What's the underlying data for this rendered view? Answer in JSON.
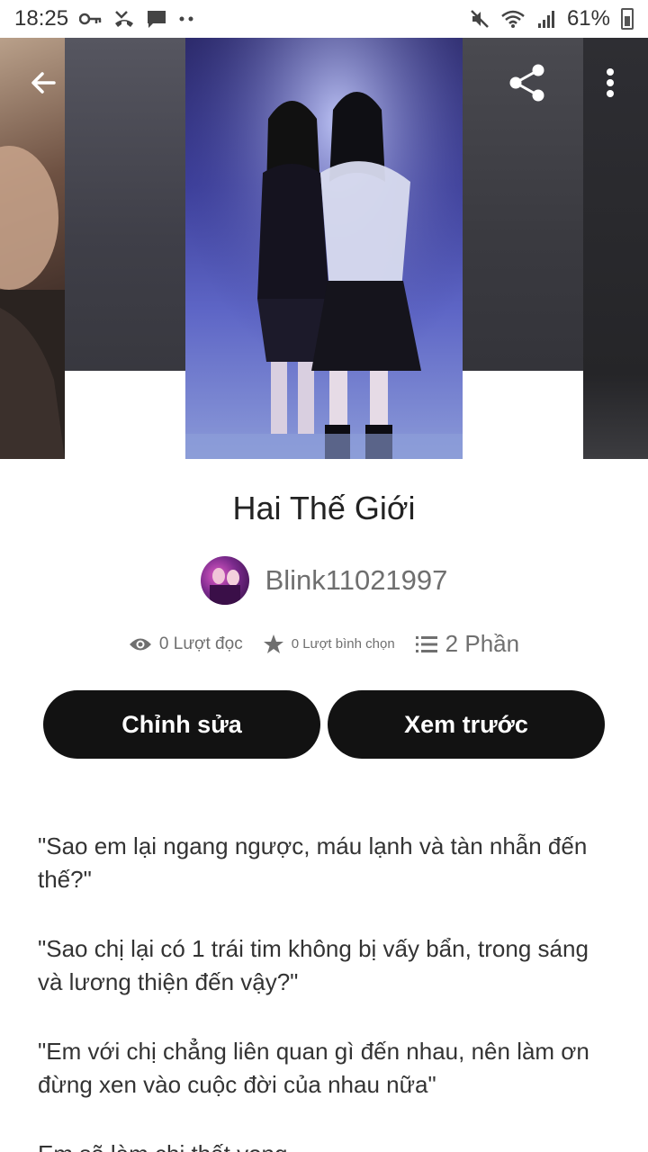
{
  "status_bar": {
    "time": "18:25",
    "battery": "61%",
    "left_icons": [
      "key-icon",
      "missed-call-icon",
      "message-icon",
      "more-dots-icon"
    ],
    "right_icons": [
      "mute-icon",
      "wifi-icon",
      "signal-icon",
      "battery-icon"
    ]
  },
  "header": {
    "back_icon": "arrow-left-icon",
    "share_icon": "share-icon",
    "more_icon": "more-vertical-icon"
  },
  "story": {
    "title": "Hai Thế Giới",
    "author": "Blink11021997",
    "stats": {
      "reads": "0 Lượt đọc",
      "votes": "0 Lượt bình chọn",
      "parts": "2 Phần"
    },
    "buttons": {
      "edit": "Chỉnh sửa",
      "preview": "Xem trước"
    },
    "description": [
      "\"Sao em lại ngang ngược, máu lạnh và tàn nhẫn đến thế?\"",
      "\"Sao chị lại có 1 trái tim không bị vấy bẩn, trong sáng và lương thiện đến vậy?\"",
      "\"Em với chị chẳng liên quan gì đến nhau, nên làm ơn đừng xen vào cuộc đời của nhau nữa\"",
      "Em sẽ làm chị thất vọng..."
    ]
  },
  "colors": {
    "button_bg": "#121212",
    "button_text": "#ffffff",
    "muted_text": "#6f6f6f"
  }
}
